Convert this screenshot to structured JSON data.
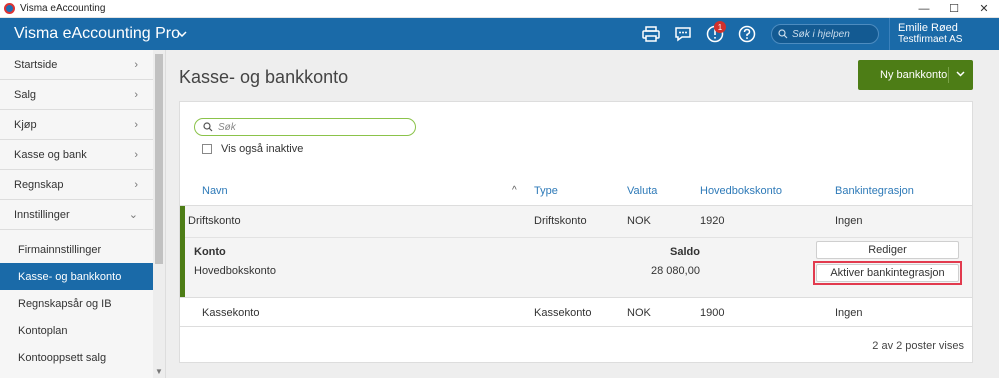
{
  "window": {
    "title": "Visma eAccounting",
    "controls": [
      "—",
      "☐",
      "✕"
    ]
  },
  "app": {
    "title": "Visma eAccounting Pro"
  },
  "header": {
    "search_placeholder": "Søk i hjelpen",
    "notifications_count": "1",
    "user_name": "Emilie Røed",
    "company": "Testfirmaet AS"
  },
  "sidebar": {
    "items": [
      {
        "label": "Startside"
      },
      {
        "label": "Salg"
      },
      {
        "label": "Kjøp"
      },
      {
        "label": "Kasse og bank"
      },
      {
        "label": "Regnskap"
      },
      {
        "label": "Innstillinger"
      }
    ],
    "subitems": [
      {
        "label": "Firmainnstillinger"
      },
      {
        "label": "Kasse- og bankkonto"
      },
      {
        "label": "Regnskapsår og IB"
      },
      {
        "label": "Kontoplan"
      },
      {
        "label": "Kontooppsett salg"
      }
    ]
  },
  "page": {
    "title": "Kasse- og bankkonto",
    "new_button": "Ny bankkonto",
    "search_placeholder": "Søk",
    "show_inactive_label": "Vis også inaktive",
    "columns": [
      "Navn",
      "Type",
      "Valuta",
      "Hovedbokskonto",
      "Bankintegrasjon"
    ],
    "rows": [
      {
        "navn": "Driftskonto",
        "type": "Driftskonto",
        "valuta": "NOK",
        "hovedbokskonto": "1920",
        "bankintegrasjon": "Ingen",
        "detail": {
          "konto_header": "Konto",
          "saldo_header": "Saldo",
          "konto_value": "Hovedbokskonto",
          "saldo_value": "28 080,00",
          "edit_button": "Rediger",
          "activate_button": "Aktiver bankintegrasjon"
        }
      },
      {
        "navn": "Kassekonto",
        "type": "Kassekonto",
        "valuta": "NOK",
        "hovedbokskonto": "1900",
        "bankintegrasjon": "Ingen"
      }
    ],
    "footer_count": "2 av 2 poster vises"
  },
  "colors": {
    "brand_blue": "#1a6aa8",
    "accent_green": "#4d7d16",
    "highlight_red": "#e23a4e"
  }
}
